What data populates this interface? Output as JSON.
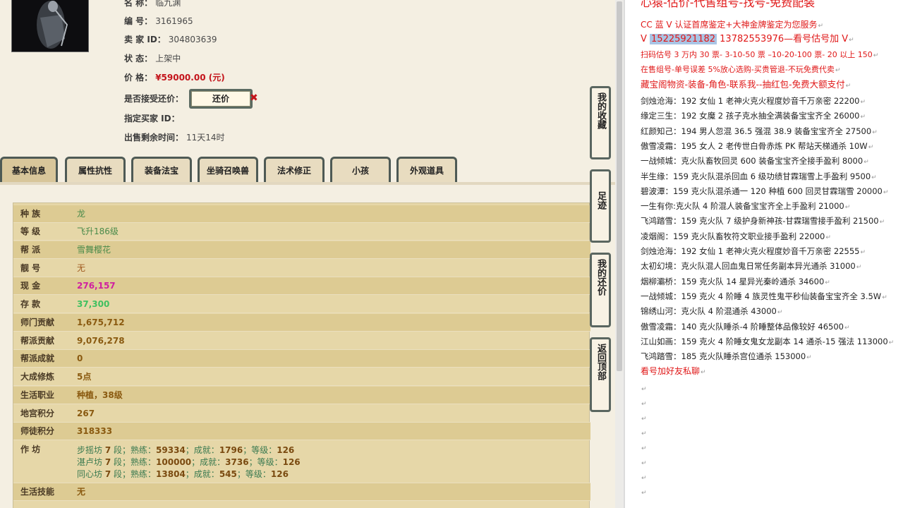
{
  "item_info": {
    "name_label": "名    称：",
    "name_value": "临九渊",
    "id_label": "编    号：",
    "id_value": "3161965",
    "seller_label": "卖  家  ID：",
    "seller_value": "304803639",
    "status_label": "状    态：",
    "status_value": "上架中",
    "price_label": "价    格：",
    "price_value": "¥59000.00 (元)",
    "counter_label": "是否接受还价：",
    "counter_button": "还价",
    "buyer_label": "指定买家 ID：",
    "buyer_value": "",
    "time_label": "出售剩余时间：",
    "time_value": "11天14时"
  },
  "tabs": [
    "基本信息",
    "属性抗性",
    "装备法宝",
    "坐骑召唤兽",
    "法术修正",
    "小孩",
    "外观道具"
  ],
  "rows": [
    {
      "key": "种    族",
      "value": "龙"
    },
    {
      "key": "等    级",
      "value": "飞升186级"
    },
    {
      "key": "帮    派",
      "value": "雪舞樱花"
    },
    {
      "key": "靓    号",
      "value": "无"
    },
    {
      "key": "现    金",
      "value": "276,157"
    },
    {
      "key": "存    款",
      "value": "37,300"
    },
    {
      "key": "师门贡献",
      "value": "1,675,712"
    },
    {
      "key": "帮派贡献",
      "value": "9,076,278"
    },
    {
      "key": "帮派成就",
      "value": "0"
    },
    {
      "key": "大成修炼",
      "value": "5点"
    },
    {
      "key": "生活职业",
      "value": "种植，38级"
    },
    {
      "key": "地宫积分",
      "value": "267"
    },
    {
      "key": "师徒积分",
      "value": "318333"
    }
  ],
  "workshop": {
    "key": "作    坊",
    "lines": [
      {
        "name": "步摇坊",
        "level": "7",
        "seg": "段；熟练：",
        "skill": "59334",
        "ach_lbl": "；成就：",
        "ach": "1796",
        "lv_lbl": "；等级：",
        "lv": "126"
      },
      {
        "name": "湛卢坊",
        "level": "7",
        "seg": "段；熟练：",
        "skill": "100000",
        "ach_lbl": "；成就：",
        "ach": "3736",
        "lv_lbl": "；等级：",
        "lv": "126"
      },
      {
        "name": "同心坊",
        "level": "7",
        "seg": "段；熟练：",
        "skill": "13804",
        "ach_lbl": "；成就：",
        "ach": "545",
        "lv_lbl": "；等级：",
        "lv": "126"
      }
    ]
  },
  "life_skill": {
    "key": "生活技能",
    "value": "无"
  },
  "side_buttons": [
    "我的收藏",
    "足迹",
    "我的还价",
    "返回顶部"
  ],
  "right_panel": {
    "header": "心猿-估价-代售组号-找号-免费配装",
    "line1": "CC 蓝 V 认证首席鉴定+大神金牌鉴定为您服务",
    "line2_prefix": "V ",
    "line2_phone1": "15225921182",
    "line2_rest": "    13782553976—看号估号加 V",
    "line3": "扫码估号 3 万内 30 票- 3-10-50 票  –10-20-100 票- 20 以上 150",
    "line4": "在售组号-单号误差 5%放心选购-买贵管退-不玩免费代卖",
    "line5": "藏宝阁物资-装备-角色-联系我--抽红包-免费大额支付",
    "listings": [
      "剑烛沧海：192 女仙 1 老神火克火程度妙音千万亲密 22200",
      "缘定三生：192 女魔 2 孩子克水抽全满装备宝宝齐全 26000",
      "红颜知己：194 男人忽混 36.5 强混 38.9 装备宝宝齐全 27500",
      "傲雪凌霜：195 女人 2 老传世白骨赤炼 PK 帮站天梯通杀 10W",
      "一战倾城：克火队畜牧回灵 600 装备宝宝齐全接手盈利 8000",
      "半生缘：159 克火队混杀回血 6 级功绩甘霖瑞雪上手盈利 9500",
      "碧波潭：159 克火队混杀通一 120 种植 600 回灵甘霖瑞雪 20000",
      "一生有你:克火队 4 阶混人装备宝宝齐全上手盈利 21000",
      "飞鸿踏雪：159 克火队 7 级护身新神孩-甘霖瑞雪接手盈利 21500",
      "凌烟阁：159 克火队畜牧符文职业接手盈利 22000",
      "剑烛沧海：192 女仙 1 老神火克火程度妙音千万亲密 22555",
      "太初幻境：克火队混人回血鬼日常任务副本异光通杀 31000",
      "烟柳灞桥：159 克火队 14 星异光秦岭通杀 34600",
      "一战倾城：159 克火 4 阶睡 4 族灵性鬼平秒仙装备宝宝齐全 3.5W",
      "锦绣山河：克火队 4 阶混通杀 43000",
      "傲雪凌霜：140 克火队睡杀-4 阶睡整体品像较好 46500",
      "江山如画：159 克火 4 阶睡女鬼女龙副本 14 通杀-15 强法 113000",
      "飞鸿踏雪：185 克火队睡杀宫位通杀 153000"
    ],
    "footer": "看号加好友私聊",
    "return_mark": "↵"
  }
}
